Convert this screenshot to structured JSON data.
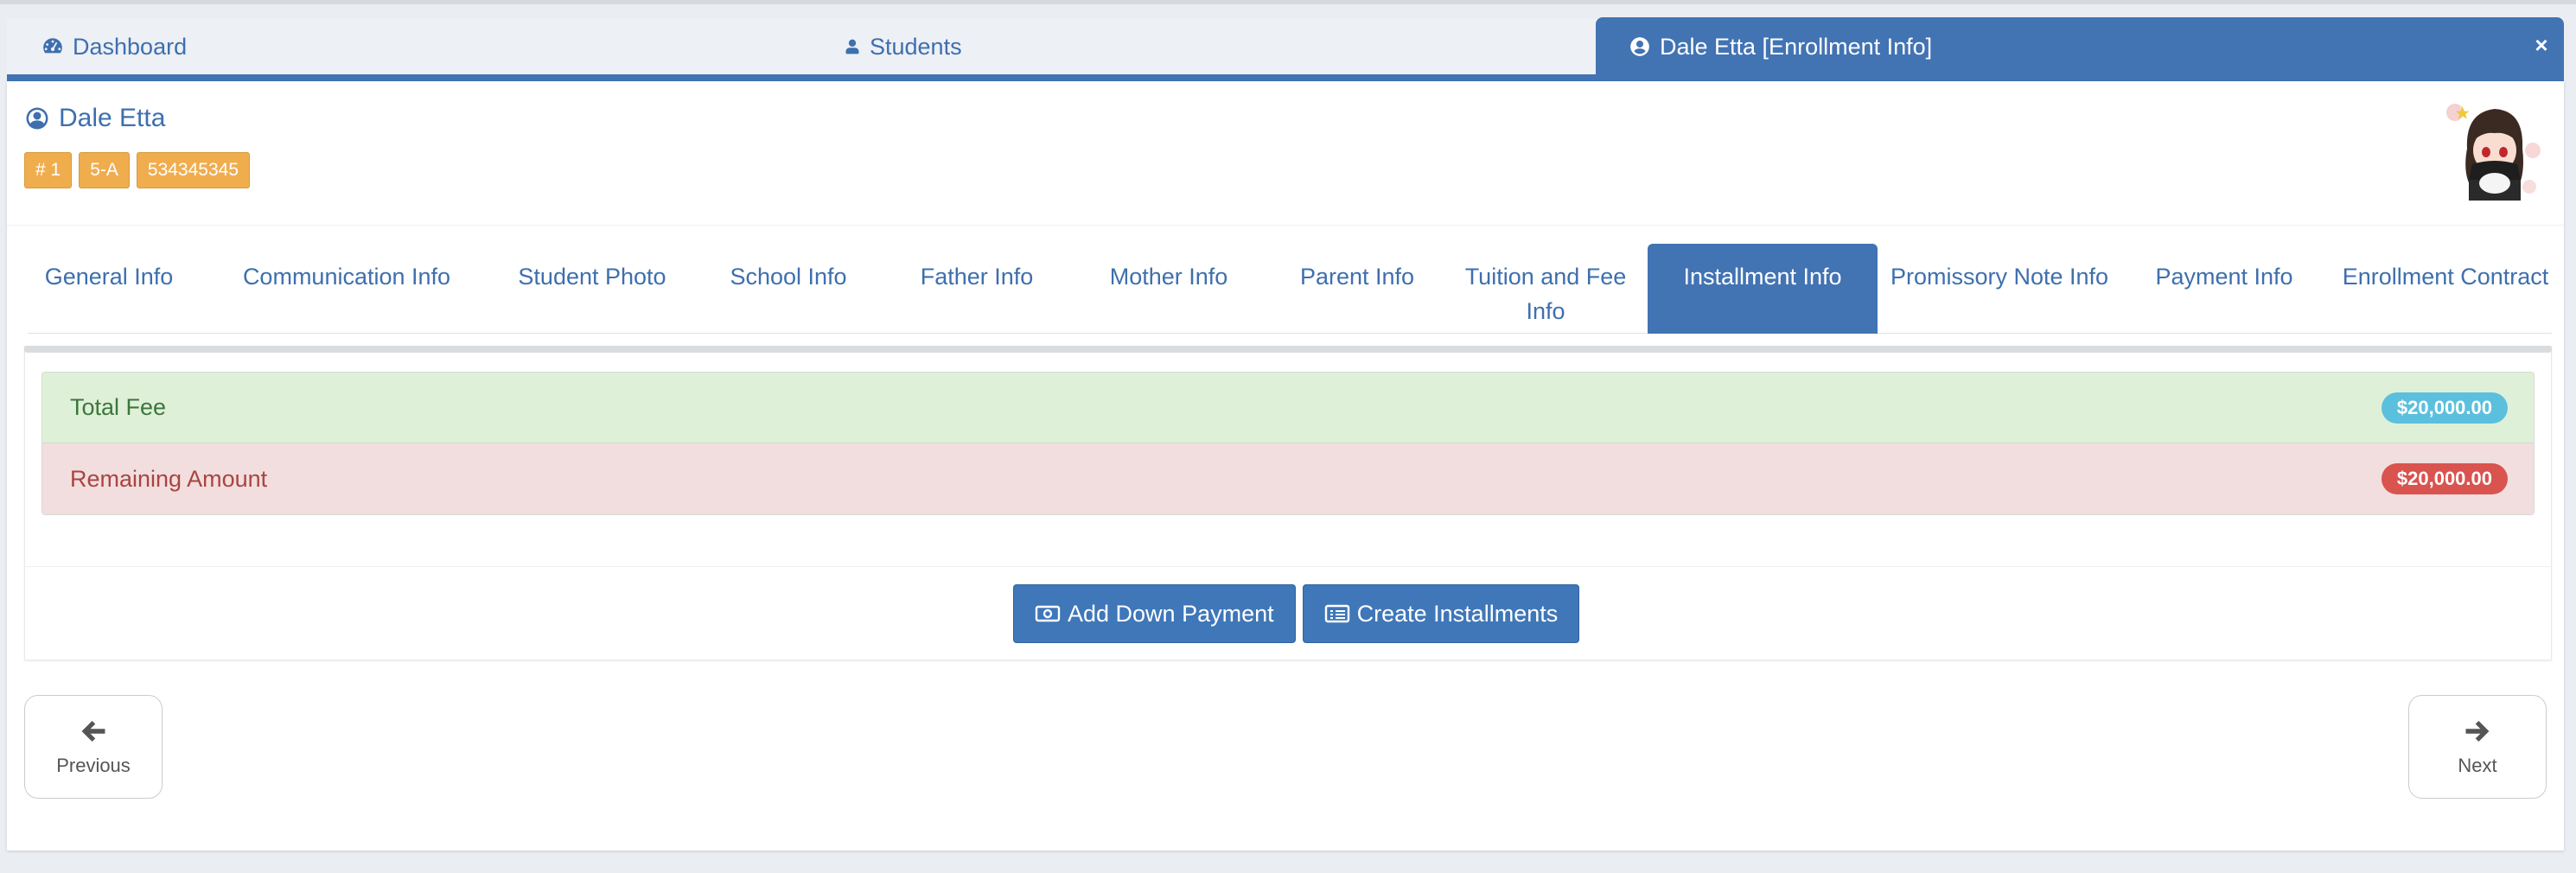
{
  "top_tabs": {
    "dashboard": {
      "label": "Dashboard",
      "icon": "tachometer-icon"
    },
    "students": {
      "label": "Students",
      "icon": "user-icon"
    },
    "active": {
      "label": "Dale Etta [Enrollment Info]",
      "icon": "user-circle-icon"
    },
    "close_glyph": "×"
  },
  "student": {
    "name": "Dale Etta",
    "badges": [
      "# 1",
      "5-A",
      "534345345"
    ]
  },
  "section_tabs": [
    {
      "label": "General Info"
    },
    {
      "label": "Communication Info"
    },
    {
      "label": "Student Photo"
    },
    {
      "label": "School Info"
    },
    {
      "label": "Father Info"
    },
    {
      "label": "Mother Info"
    },
    {
      "label": "Parent Info"
    },
    {
      "label": "Tuition and Fee Info"
    },
    {
      "label": "Installment Info"
    },
    {
      "label": "Promissory Note Info"
    },
    {
      "label": "Payment Info"
    },
    {
      "label": "Enrollment Contract"
    }
  ],
  "active_section": "Installment Info",
  "summary": {
    "total_fee": {
      "label": "Total Fee",
      "value": "$20,000.00"
    },
    "remaining": {
      "label": "Remaining Amount",
      "value": "$20,000.00"
    }
  },
  "actions": {
    "down_payment": "Add Down Payment",
    "installments": "Create Installments"
  },
  "nav": {
    "previous": "Previous",
    "next": "Next"
  },
  "colors": {
    "primary": "#4273b3",
    "badge": "#f0ad4e",
    "success_bg": "#dff0d8",
    "danger_bg": "#f2dede",
    "pill_info": "#5bc0de",
    "pill_danger": "#d9534f"
  }
}
